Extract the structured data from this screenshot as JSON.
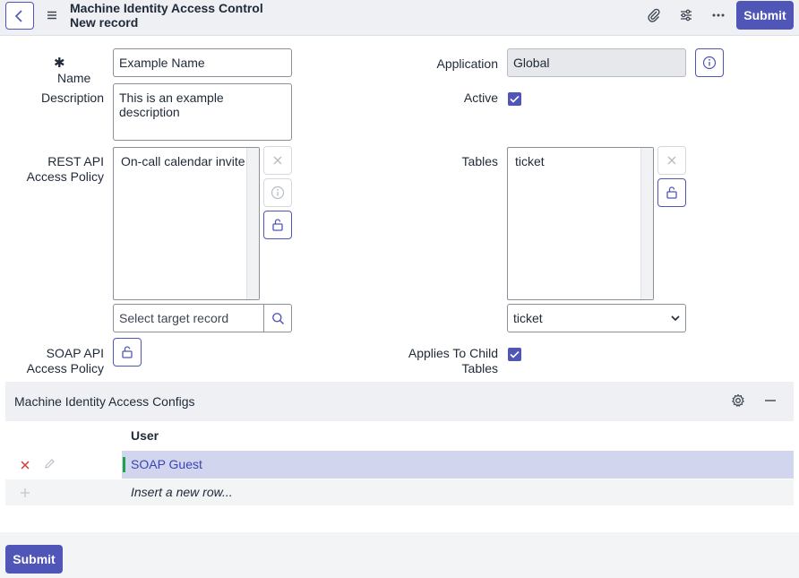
{
  "header": {
    "title": "Machine Identity Access Control",
    "subtitle": "New record",
    "submit_label": "Submit"
  },
  "form": {
    "name_required_marker": "✱",
    "name_label": "Name",
    "name_value": "Example Name",
    "description_label": "Description",
    "description_value": "This is an example description",
    "rest_label_1": "REST API",
    "rest_label_2": "Access Policy",
    "rest_items": [
      "On-call calendar invite"
    ],
    "rest_reference_placeholder": "Select target record",
    "soap_label_1": "SOAP API",
    "soap_label_2": "Access Policy",
    "application_label": "Application",
    "application_value": "Global",
    "active_label": "Active",
    "active_checked": true,
    "tables_label": "Tables",
    "tables_items": [
      "ticket"
    ],
    "tables_select_value": "ticket",
    "child_label_1": "Applies To Child",
    "child_label_2": "Tables",
    "child_checked": true
  },
  "related_list": {
    "title": "Machine Identity Access Configs",
    "column_user": "User",
    "rows": [
      {
        "user": "SOAP Guest"
      }
    ],
    "insert_label": "Insert a new row..."
  },
  "footer": {
    "submit_label": "Submit"
  },
  "colors": {
    "accent": "#5056b8",
    "header_bg": "#eef0f3",
    "selected_row": "#d2d5ee",
    "link": "#3b43b3",
    "indicator": "#1fa443",
    "delete": "#d83a3a"
  }
}
